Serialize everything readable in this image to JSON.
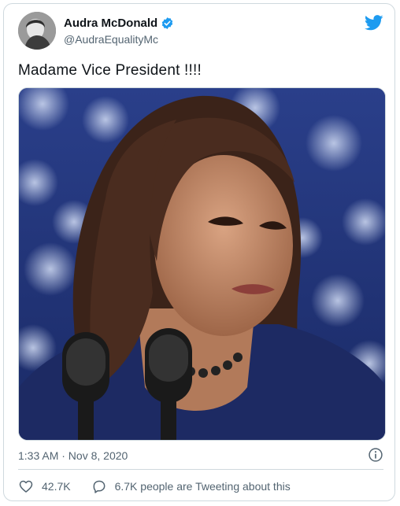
{
  "author": {
    "display_name": "Audra McDonald",
    "handle": "@AudraEqualityMc",
    "verified": true
  },
  "tweet": {
    "text": "Madame Vice President !!!!",
    "timestamp": "1:33 AM · Nov 8, 2020"
  },
  "engagement": {
    "likes": "42.7K",
    "tweeting_text": "6.7K people are Tweeting about this"
  },
  "icons": {
    "brand": "twitter-bird-icon",
    "verified": "verified-badge-icon",
    "info": "info-icon",
    "like": "heart-icon",
    "reply": "speech-bubble-icon"
  },
  "colors": {
    "brand_blue": "#1d9bf0",
    "text_primary": "#0f1419",
    "text_secondary": "#536471",
    "border": "#cfd9de"
  }
}
